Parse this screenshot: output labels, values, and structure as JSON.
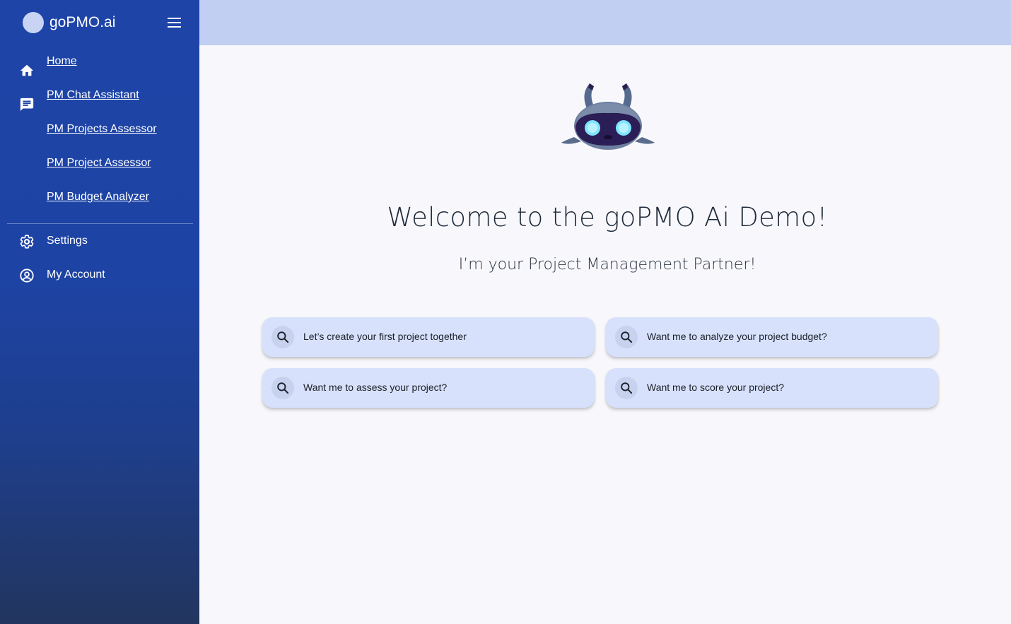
{
  "brand": {
    "name": "goPMO.ai"
  },
  "sidebar": {
    "items": [
      {
        "label": "Home",
        "icon": "home-icon"
      },
      {
        "label": "PM Chat Assistant",
        "icon": "chat-icon"
      },
      {
        "label": "PM Projects Assessor",
        "icon": ""
      },
      {
        "label": "PM Project Assessor",
        "icon": ""
      },
      {
        "label": "PM Budget Analyzer",
        "icon": ""
      }
    ],
    "bottom_items": [
      {
        "label": "Settings",
        "icon": "gear-icon"
      },
      {
        "label": "My Account",
        "icon": "account-icon"
      }
    ]
  },
  "main": {
    "welcome": "Welcome to the goPMO Ai Demo!",
    "subtitle": "I’m your Project Management Partner!",
    "suggestions": [
      {
        "text": "Let’s create your first project together",
        "icon": "search-icon"
      },
      {
        "text": "Want me to analyze your project budget?",
        "icon": "search-icon"
      },
      {
        "text": "Want me to assess your project?",
        "icon": "search-icon"
      },
      {
        "text": "Want me to score your project?",
        "icon": "search-icon"
      }
    ]
  },
  "colors": {
    "sidebar": "#1e44a8",
    "topbar": "#c0cff2",
    "card": "#d7e1fb",
    "background": "#f8f8fc"
  }
}
